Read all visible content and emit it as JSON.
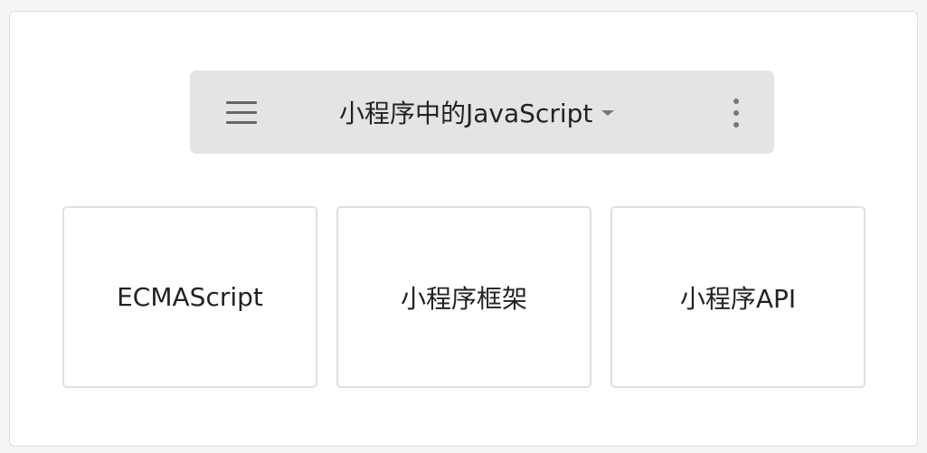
{
  "header": {
    "title": "小程序中的JavaScript",
    "menu_icon": "hamburger-menu-icon",
    "dropdown_icon": "caret-down-icon",
    "more_icon": "vertical-dots-more-icon"
  },
  "boxes": [
    {
      "label": "ECMAScript"
    },
    {
      "label": "小程序框架"
    },
    {
      "label": "小程序API"
    }
  ]
}
